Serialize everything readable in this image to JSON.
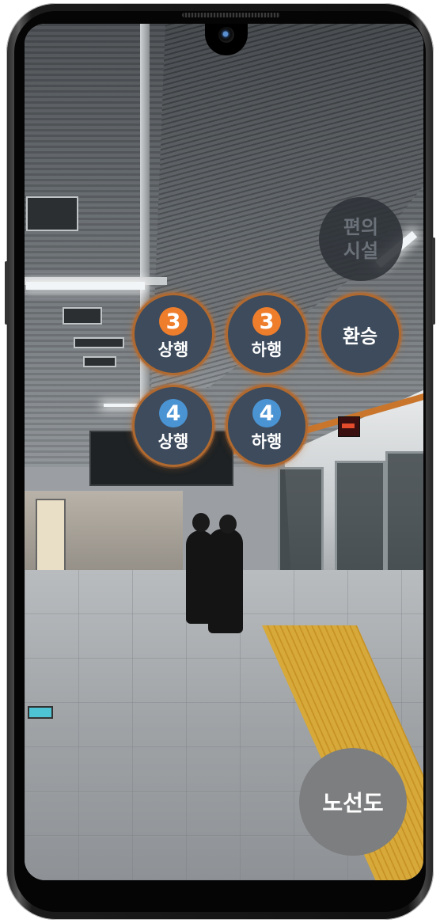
{
  "overlay": {
    "facilities": {
      "line1": "편의",
      "line2": "시설"
    },
    "transfer": {
      "label": "환승"
    },
    "line3_up": {
      "line": "3",
      "direction": "상행"
    },
    "line3_down": {
      "line": "3",
      "direction": "하행"
    },
    "line4_up": {
      "line": "4",
      "direction": "상행"
    },
    "line4_down": {
      "line": "4",
      "direction": "하행"
    },
    "route_map": {
      "label": "노선도"
    }
  },
  "colors": {
    "line3": "#ee7d2c",
    "line4": "#4a94d4",
    "button_bg": "#3d4b5c",
    "ring": "#b0692f",
    "route_map_bg": "#7d7e7f"
  },
  "icons": [
    "camera-icon",
    "line-3-badge-icon",
    "line-4-badge-icon"
  ]
}
